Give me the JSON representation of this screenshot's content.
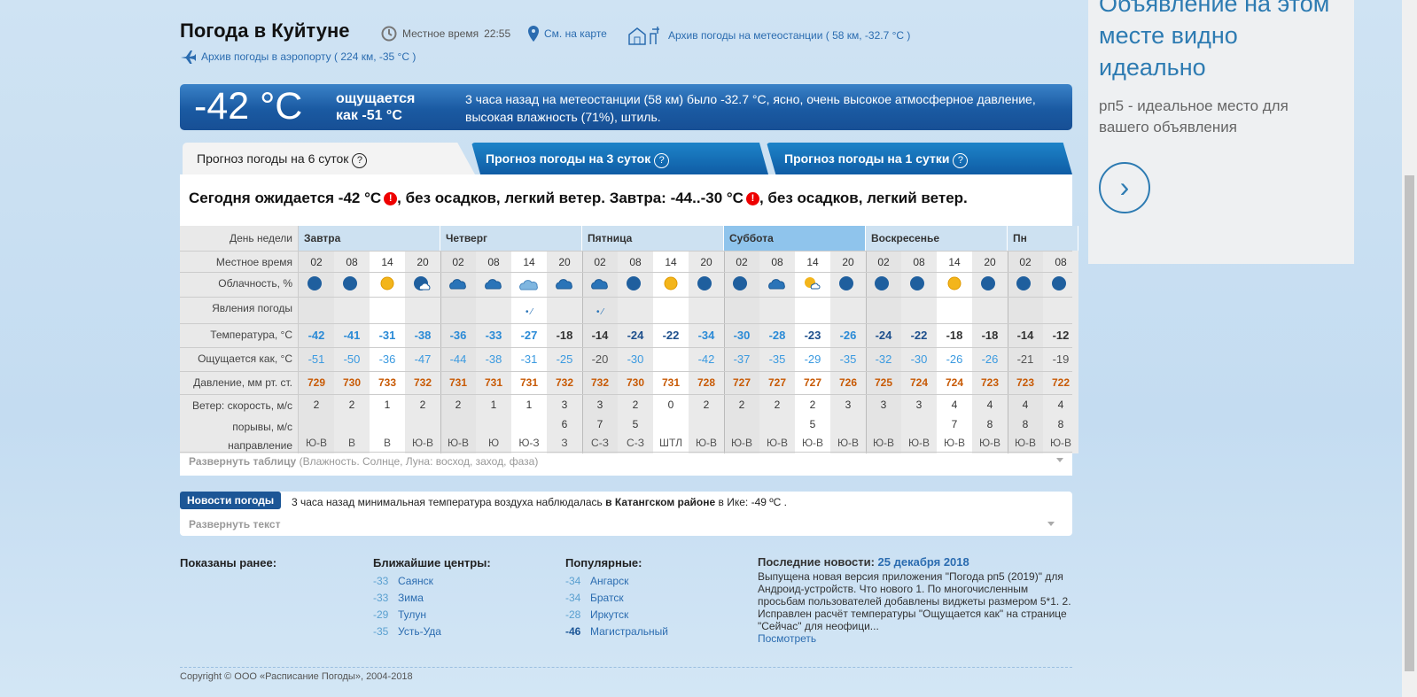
{
  "header": {
    "city": "Погода в Куйтуне",
    "local_time_label": "Местное время",
    "local_time": "22:55",
    "map_link": "См. на карте",
    "station_archive": "Архив погоды на метеостанции ( 58 км, -32.7 °C )",
    "airport_archive": "Архив погоды в аэропорту ( 224 км, -35 °C )"
  },
  "now": {
    "temp": "-42 °C",
    "feels1": "ощущается",
    "feels2": "как -51 °C",
    "text": "3 часа назад на метеостанции (58 км) было -32.7 °C, ясно, очень высокое атмосферное давление, высокая влажность (71%), штиль."
  },
  "tabs": [
    {
      "label": "Прогноз погоды на 6 суток"
    },
    {
      "label": "Прогноз погоды на 3 суток"
    },
    {
      "label": "Прогноз погоды на 1 сутки"
    }
  ],
  "summary": {
    "p1": "Сегодня ожидается -42 °C",
    "p2": ", без осадков, легкий ветер. Завтра: -44..-30 °C",
    "p3": ", без осадков, легкий ветер."
  },
  "row_labels": {
    "day": "День недели",
    "time": "Местное время",
    "cloud": "Облачность, %",
    "phen": "Явления погоды",
    "temp": "Температура, °С",
    "feels": "Ощущается как, °С",
    "pressure": "Давление, мм рт. ст.",
    "wind": "Ветер: скорость, м/с",
    "gust": "порывы, м/с",
    "dir": "направление"
  },
  "days": [
    "Завтра",
    "Четверг",
    "Пятница",
    "Суббота",
    "Воскресенье",
    "Пн"
  ],
  "hours": [
    "02",
    "08",
    "14",
    "20",
    "02",
    "08",
    "14",
    "20",
    "02",
    "08",
    "14",
    "20",
    "02",
    "08",
    "14",
    "20",
    "02",
    "08",
    "14",
    "20",
    "02",
    "08"
  ],
  "clouds": [
    "moon-clear",
    "moon-clear",
    "sun",
    "moon-cloud",
    "cloud",
    "cloud",
    "overcast",
    "cloud",
    "cloud",
    "moon-clear",
    "sun",
    "moon-clear",
    "moon-clear",
    "cloud",
    "sun-cloud",
    "moon-clear",
    "moon-clear",
    "moon-clear",
    "sun",
    "moon-clear",
    "moon-clear",
    "moon-clear"
  ],
  "temps": [
    "-42",
    "-41",
    "-31",
    "-38",
    "-36",
    "-33",
    "-27",
    "-18",
    "-14",
    "-24",
    "-22",
    "-34",
    "-30",
    "-28",
    "-23",
    "-26",
    "-24",
    "-22",
    "-18",
    "-18",
    "-14",
    "-12"
  ],
  "feels": [
    "-51",
    "-50",
    "-36",
    "-47",
    "-44",
    "-38",
    "-31",
    "-25",
    "-20",
    "-30",
    "",
    "-42",
    "-37",
    "-35",
    "-29",
    "-35",
    "-32",
    "-30",
    "-26",
    "-26",
    "-21",
    "-19"
  ],
  "pressure": [
    "729",
    "730",
    "733",
    "732",
    "731",
    "731",
    "731",
    "732",
    "732",
    "730",
    "731",
    "728",
    "727",
    "727",
    "727",
    "726",
    "725",
    "724",
    "724",
    "723",
    "723",
    "722"
  ],
  "wind": [
    "2",
    "2",
    "1",
    "2",
    "2",
    "1",
    "1",
    "3",
    "3",
    "2",
    "0",
    "2",
    "2",
    "2",
    "2",
    "3",
    "3",
    "3",
    "4",
    "4",
    "4",
    "4"
  ],
  "gust": [
    "",
    "",
    "",
    "",
    "",
    "",
    "",
    "6",
    "7",
    "5",
    "",
    "",
    "",
    "",
    "5",
    "",
    "",
    "",
    "7",
    "8",
    "8",
    "8"
  ],
  "dir": [
    "Ю-В",
    "В",
    "В",
    "Ю-В",
    "Ю-В",
    "Ю",
    "Ю-З",
    "З",
    "С-З",
    "С-З",
    "ШТЛ",
    "Ю-В",
    "Ю-В",
    "Ю-В",
    "Ю-В",
    "Ю-В",
    "Ю-В",
    "Ю-В",
    "Ю-В",
    "Ю-В",
    "Ю-В",
    "Ю-В"
  ],
  "expand_table": {
    "title": "Развернуть таблицу",
    "hint": "(Влажность. Солнце, Луна: восход, заход, фаза)"
  },
  "news": {
    "badge": "Новости погоды",
    "t1": "3 часа назад минимальная температура воздуха наблюдалась ",
    "t2": "в Катангском районе",
    "t3": " в Ике: -49 ºС .",
    "expand": "Развернуть текст"
  },
  "shown": {
    "title": "Показаны ранее:"
  },
  "nearest": {
    "title": "Ближайшие центры:",
    "items": [
      {
        "t": "-33",
        "n": "Саянск"
      },
      {
        "t": "-33",
        "n": "Зима"
      },
      {
        "t": "-29",
        "n": "Тулун"
      },
      {
        "t": "-35",
        "n": "Усть-Уда"
      }
    ]
  },
  "popular": {
    "title": "Популярные:",
    "items": [
      {
        "t": "-34",
        "n": "Ангарск"
      },
      {
        "t": "-34",
        "n": "Братск"
      },
      {
        "t": "-28",
        "n": "Иркутск"
      },
      {
        "t": "-46",
        "n": "Магистральный"
      }
    ]
  },
  "lastnews": {
    "title": "Последние новости:",
    "date": "25 декабря 2018",
    "text": "Выпущена новая версия приложения \"Погода рп5 (2019)\" для Андроид-устройств. Что нового 1. По многочисленным просьбам пользователей добавлены виджеты размером 5*1. 2. Исправлен расчёт температуры \"Ощущается как\" на странице \"Сейчас\" для неофици...",
    "more": "Посмотреть"
  },
  "copyright": "Copyright © ООО «Расписание Погоды», 2004-2018",
  "ad": {
    "head": "Объявление на этом месте видно идеально",
    "text": "рп5 - идеальное место для вашего объявления"
  }
}
